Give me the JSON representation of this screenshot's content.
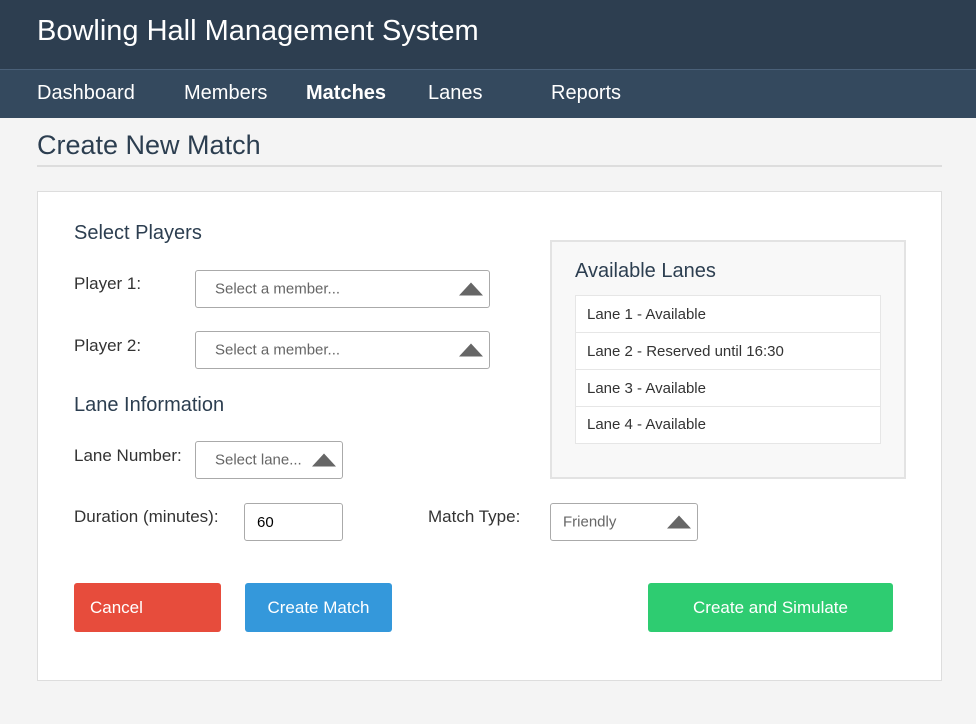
{
  "header": {
    "title": "Bowling Hall Management System"
  },
  "nav": {
    "items": [
      {
        "label": "Dashboard"
      },
      {
        "label": "Members"
      },
      {
        "label": "Matches"
      },
      {
        "label": "Lanes"
      },
      {
        "label": "Reports"
      }
    ],
    "active": "Matches"
  },
  "page": {
    "title": "Create New Match"
  },
  "form": {
    "players_heading": "Select Players",
    "player1": {
      "label": "Player 1:",
      "placeholder": "Select a member..."
    },
    "player2": {
      "label": "Player 2:",
      "placeholder": "Select a member..."
    },
    "lane_heading": "Lane Information",
    "lane_number": {
      "label": "Lane Number:",
      "placeholder": "Select lane..."
    },
    "duration": {
      "label": "Duration (minutes):",
      "value": "60"
    },
    "match_type": {
      "label": "Match Type:",
      "value": "Friendly"
    }
  },
  "available_lanes": {
    "title": "Available Lanes",
    "items": [
      "Lane 1 - Available",
      "Lane 2 - Reserved until 16:30",
      "Lane 3 - Available",
      "Lane 4 - Available"
    ]
  },
  "buttons": {
    "cancel": "Cancel",
    "create": "Create Match",
    "simulate": "Create and Simulate"
  },
  "colors": {
    "header_bg": "#2d3e50",
    "nav_bg": "#34495e",
    "cancel": "#e74c3c",
    "create": "#3498db",
    "simulate": "#2ecc71"
  },
  "icons": {
    "select_caret": "caret-up-icon"
  }
}
